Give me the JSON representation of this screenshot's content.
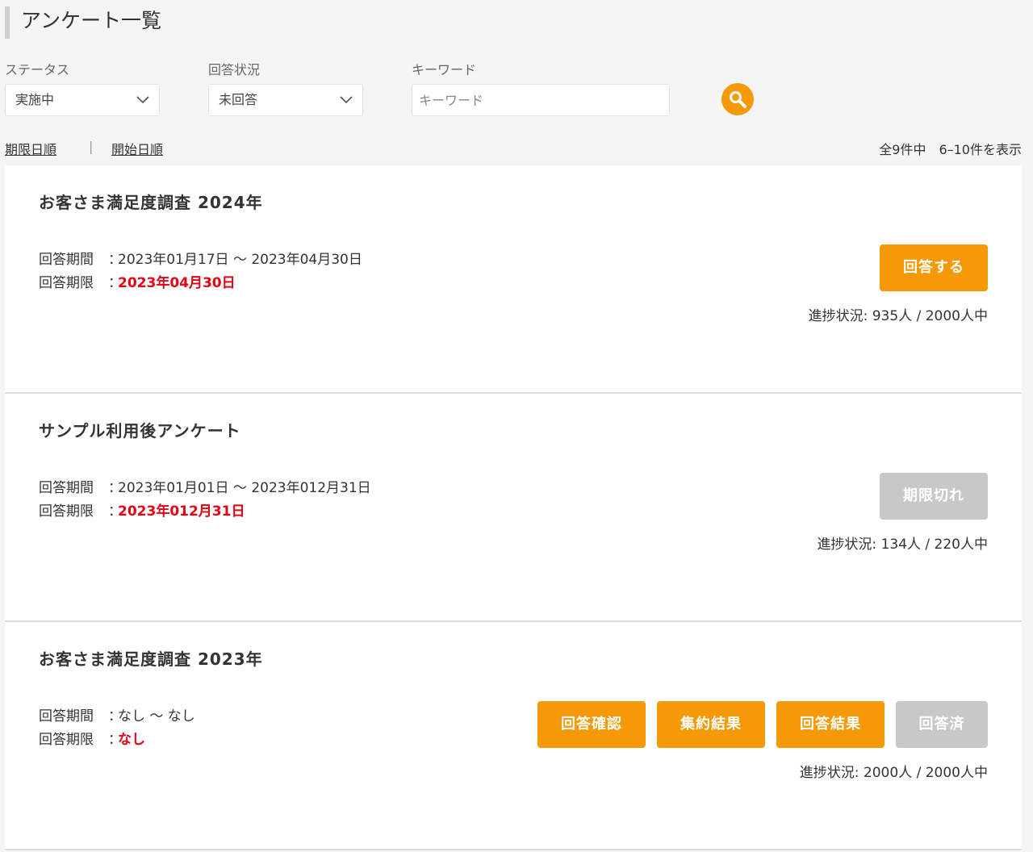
{
  "page": {
    "title": "アンケート一覧"
  },
  "filters": {
    "status": {
      "label": "ステータス",
      "value": "実施中"
    },
    "answer": {
      "label": "回答状況",
      "value": "未回答"
    },
    "keyword": {
      "label": "キーワード",
      "placeholder": "キーワード"
    }
  },
  "sort": {
    "by_deadline": "期限日順",
    "separator": "|",
    "by_start": "開始日順"
  },
  "count": "全9件中　6–10件を表示",
  "labels": {
    "period": "回答期間",
    "deadline": "回答期限",
    "colon": "："
  },
  "cards": [
    {
      "title": "お客さま満足度調査 2024年",
      "period": "2023年01月17日 ～ 2023年04月30日",
      "deadline": "2023年04月30日",
      "buttons": [
        "回答する"
      ],
      "progress": "進捗状況: 935人 / 2000人中"
    },
    {
      "title": "サンプル利用後アンケート",
      "period": "2023年01月01日 ～ 2023年012月31日",
      "deadline": "2023年012月31日",
      "buttons": [
        "期限切れ"
      ],
      "progress": "進捗状況: 134人 / 220人中"
    },
    {
      "title": "お客さま満足度調査 2023年",
      "period": "なし ～ なし",
      "deadline": "なし",
      "buttons": [
        "回答確認",
        "集約結果",
        "回答結果",
        "回答済"
      ],
      "progress": "進捗状況: 2000人 / 2000人中"
    }
  ],
  "colors": {
    "accent": "#f59a06",
    "disabled": "#c8c8c8",
    "deadline": "#e60012"
  },
  "icons": {
    "search": "search-icon",
    "select": "chevron-down-icon"
  }
}
